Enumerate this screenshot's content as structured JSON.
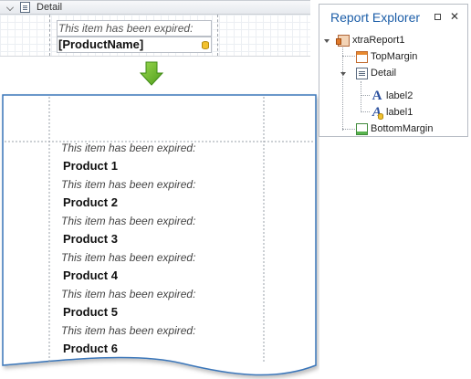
{
  "designer": {
    "band_title": "Detail",
    "label2_text": "This item has been expired:",
    "label1_text": "[ProductName]"
  },
  "preview": {
    "rows": [
      {
        "caption": "This item has been expired:",
        "name": "Product 1"
      },
      {
        "caption": "This item has been expired:",
        "name": "Product 2"
      },
      {
        "caption": "This item has been expired:",
        "name": "Product 3"
      },
      {
        "caption": "This item has been expired:",
        "name": "Product 4"
      },
      {
        "caption": "This item has been expired:",
        "name": "Product 5"
      },
      {
        "caption": "This item has been expired:",
        "name": "Product 6"
      }
    ]
  },
  "explorer": {
    "title": "Report Explorer",
    "tree": {
      "root": "xtraReport1",
      "top_margin": "TopMargin",
      "detail": "Detail",
      "label2": "label2",
      "label1": "label1",
      "bottom_margin": "BottomMargin"
    }
  },
  "colors": {
    "accent": "#1c5ea8",
    "arrow": "#6dbb2e",
    "paper_border": "#3b76b9"
  },
  "icons": [
    "detail-band-icon",
    "database-icon",
    "down-arrow-icon",
    "pin-icon",
    "close-icon",
    "report-icon",
    "top-margin-icon",
    "bottom-margin-icon",
    "label-icon",
    "data-label-icon"
  ]
}
